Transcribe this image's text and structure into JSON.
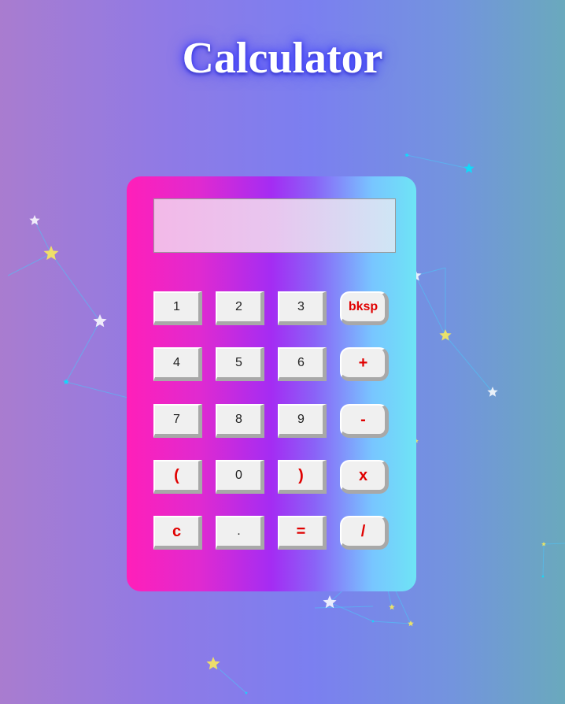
{
  "title": "Calculator",
  "display": {
    "value": ""
  },
  "colors": {
    "operator": "#e00000",
    "digit": "#222222"
  },
  "keys": [
    {
      "label": "1",
      "name": "key-1",
      "style": "digit"
    },
    {
      "label": "2",
      "name": "key-2",
      "style": "digit"
    },
    {
      "label": "3",
      "name": "key-3",
      "style": "digit"
    },
    {
      "label": "bksp",
      "name": "key-backspace",
      "style": "op-round"
    },
    {
      "label": "4",
      "name": "key-4",
      "style": "digit"
    },
    {
      "label": "5",
      "name": "key-5",
      "style": "digit"
    },
    {
      "label": "6",
      "name": "key-6",
      "style": "digit"
    },
    {
      "label": "+",
      "name": "key-plus",
      "style": "op-round"
    },
    {
      "label": "7",
      "name": "key-7",
      "style": "digit"
    },
    {
      "label": "8",
      "name": "key-8",
      "style": "digit"
    },
    {
      "label": "9",
      "name": "key-9",
      "style": "digit"
    },
    {
      "label": "-",
      "name": "key-minus",
      "style": "op-round"
    },
    {
      "label": "(",
      "name": "key-open-paren",
      "style": "op"
    },
    {
      "label": "0",
      "name": "key-0",
      "style": "digit"
    },
    {
      "label": ")",
      "name": "key-close-paren",
      "style": "op"
    },
    {
      "label": "x",
      "name": "key-multiply",
      "style": "op-round"
    },
    {
      "label": "c",
      "name": "key-clear",
      "style": "op"
    },
    {
      "label": ".",
      "name": "key-decimal",
      "style": "digit"
    },
    {
      "label": "=",
      "name": "key-equals",
      "style": "op"
    },
    {
      "label": "/",
      "name": "key-divide",
      "style": "op-round"
    }
  ]
}
